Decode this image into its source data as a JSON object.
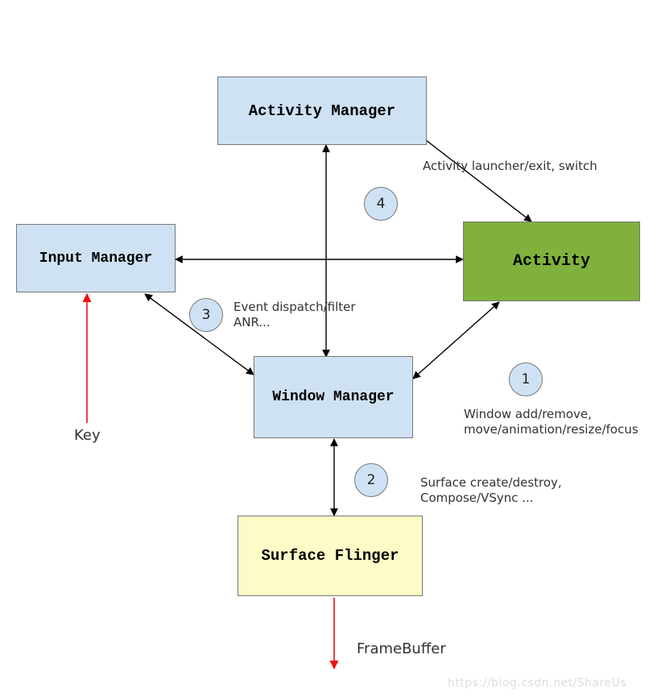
{
  "boxes": {
    "activity_manager": "Activity Manager",
    "input_manager": "Input Manager",
    "activity": "Activity",
    "window_manager": "Window Manager",
    "surface_flinger": "Surface Flinger"
  },
  "circles": {
    "c1": "1",
    "c2": "2",
    "c3": "3",
    "c4": "4"
  },
  "labels": {
    "activity_launcher": "Activity launcher/exit, switch",
    "event_dispatch": "Event dispatch/filter\nANR...",
    "window_ops": "Window add/remove,\nmove/animation/resize/focus",
    "surface_ops": "Surface create/destroy,\nCompose/VSync ...",
    "key": "Key",
    "framebuffer": "FrameBuffer"
  },
  "watermark": "https://blog.csdn.net/ShareUs"
}
